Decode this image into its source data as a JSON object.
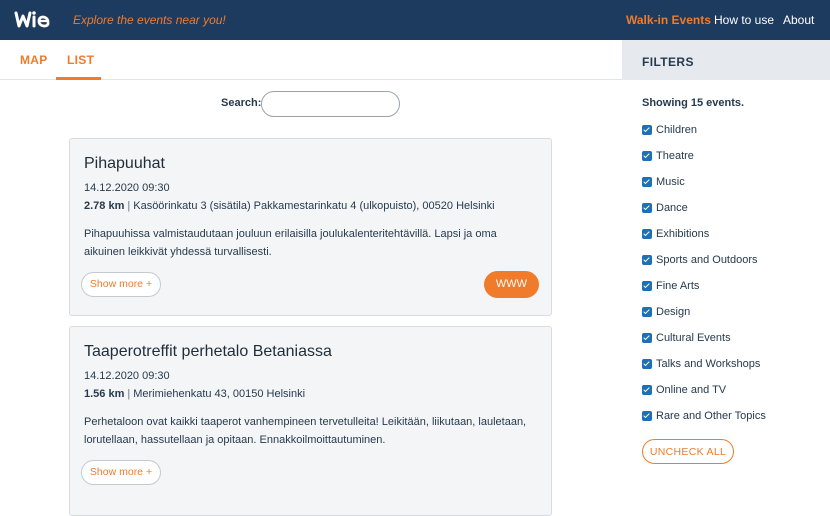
{
  "header": {
    "logo": "wie",
    "tagline": "Explore the events near you!",
    "nav": [
      {
        "label": "Walk-in Events"
      },
      {
        "label": "How to use"
      },
      {
        "label": "About"
      }
    ]
  },
  "tabs": [
    {
      "label": "MAP"
    },
    {
      "label": "LIST"
    }
  ],
  "search": {
    "label": "Search:",
    "value": "",
    "placeholder": ""
  },
  "events": [
    {
      "title": "Pihapuuhat",
      "date": "14.12.2020 09:30",
      "distance": "2.78 km",
      "separator": "|",
      "location": "Kasöörinkatu 3 (sisätila) Pakkamestarinkatu 4 (ulkopuisto), 00520 Helsinki",
      "description": "Pihapuuhissa valmistaudutaan jouluun erilaisilla joulukalenteritehtävillä. Lapsi ja oma aikuinen leikkivät yhdessä turvallisesti.",
      "show_more": "Show more +",
      "www": "WWW"
    },
    {
      "title": "Taaperotreffit perhetalo Betaniassa",
      "date": "14.12.2020 09:30",
      "distance": "1.56 km",
      "separator": "|",
      "location": "Merimiehenkatu 43, 00150 Helsinki",
      "description": "Perhetaloon ovat kaikki taaperot vanhempineen tervetulleita! Leikitään, liikutaan, lauletaan, lorutellaan, hassutellaan ja opitaan. Ennakkoilmoittautuminen.",
      "show_more": "Show more +"
    }
  ],
  "filters": {
    "title": "FILTERS",
    "showing": "Showing 15 events.",
    "items": [
      {
        "label": "Children",
        "checked": true
      },
      {
        "label": "Theatre",
        "checked": true
      },
      {
        "label": "Music",
        "checked": true
      },
      {
        "label": "Dance",
        "checked": true
      },
      {
        "label": "Exhibitions",
        "checked": true
      },
      {
        "label": "Sports and Outdoors",
        "checked": true
      },
      {
        "label": "Fine Arts",
        "checked": true
      },
      {
        "label": "Design",
        "checked": true
      },
      {
        "label": "Cultural Events",
        "checked": true
      },
      {
        "label": "Talks and Workshops",
        "checked": true
      },
      {
        "label": "Online and TV",
        "checked": true
      },
      {
        "label": "Rare and Other Topics",
        "checked": true
      }
    ],
    "uncheck_all": "UNCHECK ALL"
  },
  "colors": {
    "navbar": "#1d3a5f",
    "accent": "#f07b2a",
    "checkbox": "#1d6fb8"
  }
}
